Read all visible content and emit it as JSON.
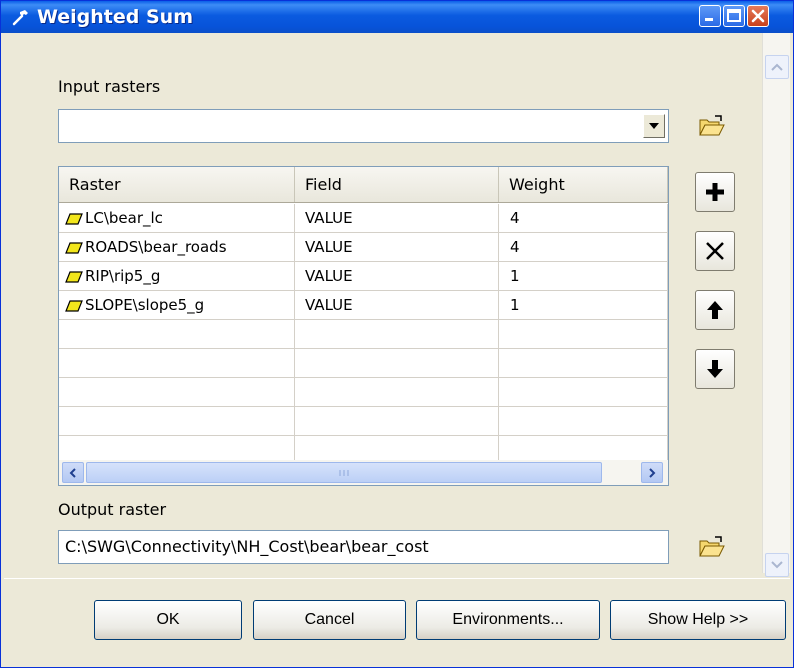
{
  "window": {
    "title": "Weighted Sum",
    "app_icon": "hammer-icon",
    "controls": [
      "minimize-icon",
      "maximize-icon",
      "close-icon"
    ]
  },
  "input_rasters": {
    "label": "Input rasters",
    "value": "",
    "browse_icon": "open-folder-icon"
  },
  "table": {
    "columns": [
      "Raster",
      "Field",
      "Weight"
    ],
    "rows": [
      {
        "raster": "LC\\bear_lc",
        "field": "VALUE",
        "weight": "4"
      },
      {
        "raster": "ROADS\\bear_roads",
        "field": "VALUE",
        "weight": "4"
      },
      {
        "raster": "RIP\\rip5_g",
        "field": "VALUE",
        "weight": "1"
      },
      {
        "raster": "SLOPE\\slope5_g",
        "field": "VALUE",
        "weight": "1"
      }
    ],
    "empty_rows": 5,
    "layer_icon": "raster-layer-icon"
  },
  "side_buttons": [
    "add-icon",
    "remove-icon",
    "move-up-icon",
    "move-down-icon"
  ],
  "output_raster": {
    "label": "Output raster",
    "value": "C:\\SWG\\Connectivity\\NH_Cost\\bear\\bear_cost",
    "browse_icon": "open-folder-icon"
  },
  "buttons": {
    "ok": "OK",
    "cancel": "Cancel",
    "environments": "Environments...",
    "help": "Show Help >>"
  },
  "colors": {
    "titlebar": "#0a5fe8",
    "dialog_bg": "#ece9d8",
    "close": "#c8411c"
  }
}
